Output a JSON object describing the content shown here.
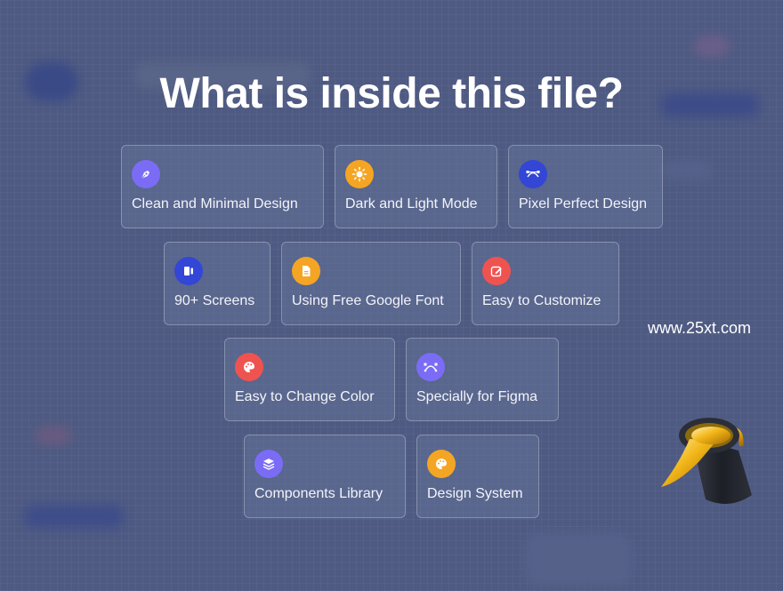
{
  "heading": "What is inside this file?",
  "features": [
    {
      "label": "Clean and Minimal Design",
      "icon": "pen-nib-icon",
      "color": "#7b6cf6"
    },
    {
      "label": "Dark and Light Mode",
      "icon": "sun-icon",
      "color": "#f5a524"
    },
    {
      "label": "Pixel Perfect Design",
      "icon": "bezier-curve-icon",
      "color": "#3346d6"
    },
    {
      "label": "90+ Screens",
      "icon": "screens-icon",
      "color": "#3346d6"
    },
    {
      "label": "Using Free Google Font",
      "icon": "document-icon",
      "color": "#f5a524"
    },
    {
      "label": "Easy to Customize",
      "icon": "edit-icon",
      "color": "#ef5350"
    },
    {
      "label": "Easy to Change Color",
      "icon": "palette-icon",
      "color": "#ef5350"
    },
    {
      "label": "Specially for Figma",
      "icon": "vector-nodes-icon",
      "color": "#7b6cf6"
    },
    {
      "label": "Components Library",
      "icon": "layers-icon",
      "color": "#7b6cf6"
    },
    {
      "label": "Design System",
      "icon": "palette-icon",
      "color": "#f5a524"
    }
  ],
  "watermark": "www.25xt.com"
}
